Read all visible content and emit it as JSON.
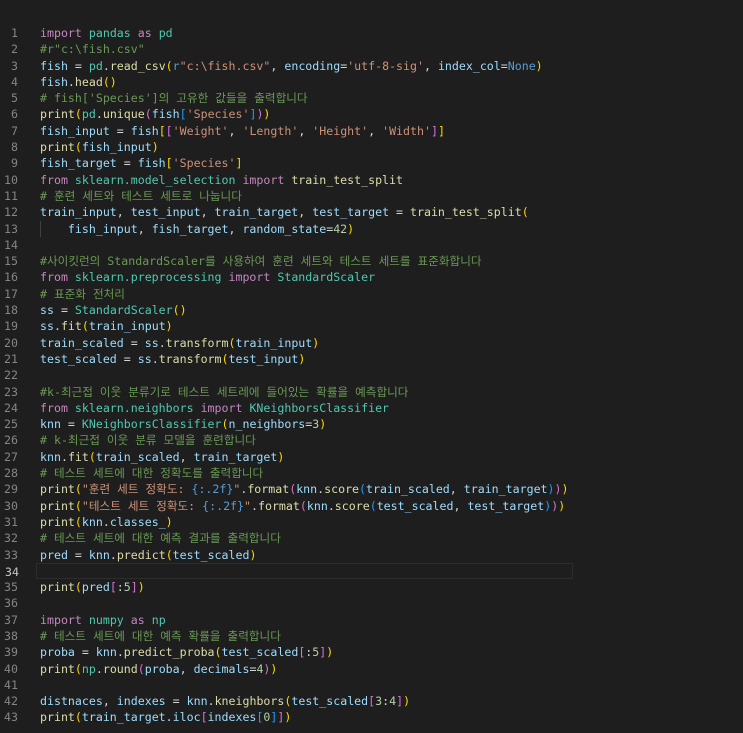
{
  "editor": {
    "current_line": 34,
    "lines": [
      [
        [
          "k",
          "import"
        ],
        [
          "p",
          " "
        ],
        [
          "t",
          "pandas"
        ],
        [
          "p",
          " "
        ],
        [
          "k",
          "as"
        ],
        [
          "p",
          " "
        ],
        [
          "t",
          "pd"
        ]
      ],
      [
        [
          "c",
          "#r\"c:\\fish.csv\""
        ]
      ],
      [
        [
          "v",
          "fish"
        ],
        [
          "p",
          " = "
        ],
        [
          "t",
          "pd"
        ],
        [
          "p",
          "."
        ],
        [
          "f",
          "read_csv"
        ],
        [
          "b1",
          "("
        ],
        [
          "kb",
          "r"
        ],
        [
          "s",
          "\"c:\\fish.csv\""
        ],
        [
          "p",
          ", "
        ],
        [
          "v",
          "encoding"
        ],
        [
          "p",
          "="
        ],
        [
          "s",
          "'utf-8-sig'"
        ],
        [
          "p",
          ", "
        ],
        [
          "v",
          "index_col"
        ],
        [
          "p",
          "="
        ],
        [
          "kb",
          "None"
        ],
        [
          "b1",
          ")"
        ]
      ],
      [
        [
          "v",
          "fish"
        ],
        [
          "p",
          "."
        ],
        [
          "f",
          "head"
        ],
        [
          "b1",
          "()"
        ]
      ],
      [
        [
          "c",
          "# fish['Species']의 고유한 값들을 출력합니다"
        ]
      ],
      [
        [
          "f",
          "print"
        ],
        [
          "b1",
          "("
        ],
        [
          "t",
          "pd"
        ],
        [
          "p",
          "."
        ],
        [
          "f",
          "unique"
        ],
        [
          "b2",
          "("
        ],
        [
          "v",
          "fish"
        ],
        [
          "b3",
          "["
        ],
        [
          "s",
          "'Species'"
        ],
        [
          "b3",
          "]"
        ],
        [
          "b2",
          ")"
        ],
        [
          "b1",
          ")"
        ]
      ],
      [
        [
          "v",
          "fish_input"
        ],
        [
          "p",
          " = "
        ],
        [
          "v",
          "fish"
        ],
        [
          "b1",
          "["
        ],
        [
          "b2",
          "["
        ],
        [
          "s",
          "'Weight'"
        ],
        [
          "p",
          ", "
        ],
        [
          "s",
          "'Length'"
        ],
        [
          "p",
          ", "
        ],
        [
          "s",
          "'Height'"
        ],
        [
          "p",
          ", "
        ],
        [
          "s",
          "'Width'"
        ],
        [
          "b2",
          "]"
        ],
        [
          "b1",
          "]"
        ]
      ],
      [
        [
          "f",
          "print"
        ],
        [
          "b1",
          "("
        ],
        [
          "v",
          "fish_input"
        ],
        [
          "b1",
          ")"
        ]
      ],
      [
        [
          "v",
          "fish_target"
        ],
        [
          "p",
          " = "
        ],
        [
          "v",
          "fish"
        ],
        [
          "b1",
          "["
        ],
        [
          "s",
          "'Species'"
        ],
        [
          "b1",
          "]"
        ]
      ],
      [
        [
          "k",
          "from"
        ],
        [
          "p",
          " "
        ],
        [
          "t",
          "sklearn.model_selection"
        ],
        [
          "p",
          " "
        ],
        [
          "k",
          "import"
        ],
        [
          "p",
          " "
        ],
        [
          "f",
          "train_test_split"
        ]
      ],
      [
        [
          "c",
          "# 훈련 세트와 테스트 세트로 나눕니다"
        ]
      ],
      [
        [
          "v",
          "train_input"
        ],
        [
          "p",
          ", "
        ],
        [
          "v",
          "test_input"
        ],
        [
          "p",
          ", "
        ],
        [
          "v",
          "train_target"
        ],
        [
          "p",
          ", "
        ],
        [
          "v",
          "test_target"
        ],
        [
          "p",
          " = "
        ],
        [
          "f",
          "train_test_split"
        ],
        [
          "b1",
          "("
        ]
      ],
      [
        [
          "p",
          "    "
        ],
        [
          "v",
          "fish_input"
        ],
        [
          "p",
          ", "
        ],
        [
          "v",
          "fish_target"
        ],
        [
          "p",
          ", "
        ],
        [
          "v",
          "random_state"
        ],
        [
          "p",
          "="
        ],
        [
          "n",
          "42"
        ],
        [
          "b1",
          ")"
        ]
      ],
      [],
      [
        [
          "c",
          "#사이킷런의 StandardScaler를 사용하여 훈련 세트와 테스트 세트를 표준화합니다"
        ]
      ],
      [
        [
          "k",
          "from"
        ],
        [
          "p",
          " "
        ],
        [
          "t",
          "sklearn.preprocessing"
        ],
        [
          "p",
          " "
        ],
        [
          "k",
          "import"
        ],
        [
          "p",
          " "
        ],
        [
          "t",
          "StandardScaler"
        ]
      ],
      [
        [
          "c",
          "# 표준화 전처리"
        ]
      ],
      [
        [
          "v",
          "ss"
        ],
        [
          "p",
          " = "
        ],
        [
          "t",
          "StandardScaler"
        ],
        [
          "b1",
          "()"
        ]
      ],
      [
        [
          "v",
          "ss"
        ],
        [
          "p",
          "."
        ],
        [
          "f",
          "fit"
        ],
        [
          "b1",
          "("
        ],
        [
          "v",
          "train_input"
        ],
        [
          "b1",
          ")"
        ]
      ],
      [
        [
          "v",
          "train_scaled"
        ],
        [
          "p",
          " = "
        ],
        [
          "v",
          "ss"
        ],
        [
          "p",
          "."
        ],
        [
          "f",
          "transform"
        ],
        [
          "b1",
          "("
        ],
        [
          "v",
          "train_input"
        ],
        [
          "b1",
          ")"
        ]
      ],
      [
        [
          "v",
          "test_scaled"
        ],
        [
          "p",
          " = "
        ],
        [
          "v",
          "ss"
        ],
        [
          "p",
          "."
        ],
        [
          "f",
          "transform"
        ],
        [
          "b1",
          "("
        ],
        [
          "v",
          "test_input"
        ],
        [
          "b1",
          ")"
        ]
      ],
      [],
      [
        [
          "c",
          "#k-최근접 이웃 분류기로 테스트 세트레에 들어있는 확률을 예측합니다"
        ]
      ],
      [
        [
          "k",
          "from"
        ],
        [
          "p",
          " "
        ],
        [
          "t",
          "sklearn.neighbors"
        ],
        [
          "p",
          " "
        ],
        [
          "k",
          "import"
        ],
        [
          "p",
          " "
        ],
        [
          "t",
          "KNeighborsClassifier"
        ]
      ],
      [
        [
          "v",
          "knn"
        ],
        [
          "p",
          " = "
        ],
        [
          "t",
          "KNeighborsClassifier"
        ],
        [
          "b1",
          "("
        ],
        [
          "v",
          "n_neighbors"
        ],
        [
          "p",
          "="
        ],
        [
          "n",
          "3"
        ],
        [
          "b1",
          ")"
        ]
      ],
      [
        [
          "c",
          "# k-최근접 이웃 분류 모델을 훈련합니다"
        ]
      ],
      [
        [
          "v",
          "knn"
        ],
        [
          "p",
          "."
        ],
        [
          "f",
          "fit"
        ],
        [
          "b1",
          "("
        ],
        [
          "v",
          "train_scaled"
        ],
        [
          "p",
          ", "
        ],
        [
          "v",
          "train_target"
        ],
        [
          "b1",
          ")"
        ]
      ],
      [
        [
          "c",
          "# 테스트 세트에 대한 정확도를 출력합니다"
        ]
      ],
      [
        [
          "f",
          "print"
        ],
        [
          "b1",
          "("
        ],
        [
          "s",
          "\"훈련 세트 정확도: "
        ],
        [
          "kb",
          "{:.2f}"
        ],
        [
          "s",
          "\""
        ],
        [
          "p",
          "."
        ],
        [
          "f",
          "format"
        ],
        [
          "b2",
          "("
        ],
        [
          "v",
          "knn"
        ],
        [
          "p",
          "."
        ],
        [
          "f",
          "score"
        ],
        [
          "b3",
          "("
        ],
        [
          "v",
          "train_scaled"
        ],
        [
          "p",
          ", "
        ],
        [
          "v",
          "train_target"
        ],
        [
          "b3",
          ")"
        ],
        [
          "b2",
          ")"
        ],
        [
          "b1",
          ")"
        ]
      ],
      [
        [
          "f",
          "print"
        ],
        [
          "b1",
          "("
        ],
        [
          "s",
          "\"테스트 세트 정확도: "
        ],
        [
          "kb",
          "{:.2f}"
        ],
        [
          "s",
          "\""
        ],
        [
          "p",
          "."
        ],
        [
          "f",
          "format"
        ],
        [
          "b2",
          "("
        ],
        [
          "v",
          "knn"
        ],
        [
          "p",
          "."
        ],
        [
          "f",
          "score"
        ],
        [
          "b3",
          "("
        ],
        [
          "v",
          "test_scaled"
        ],
        [
          "p",
          ", "
        ],
        [
          "v",
          "test_target"
        ],
        [
          "b3",
          ")"
        ],
        [
          "b2",
          ")"
        ],
        [
          "b1",
          ")"
        ]
      ],
      [
        [
          "f",
          "print"
        ],
        [
          "b1",
          "("
        ],
        [
          "v",
          "knn"
        ],
        [
          "p",
          "."
        ],
        [
          "v",
          "classes_"
        ],
        [
          "b1",
          ")"
        ]
      ],
      [
        [
          "c",
          "# 테스트 세트에 대한 예측 결과를 출력합니다"
        ]
      ],
      [
        [
          "v",
          "pred"
        ],
        [
          "p",
          " = "
        ],
        [
          "v",
          "knn"
        ],
        [
          "p",
          "."
        ],
        [
          "f",
          "predict"
        ],
        [
          "b1",
          "("
        ],
        [
          "v",
          "test_scaled"
        ],
        [
          "b1",
          ")"
        ]
      ],
      [],
      [
        [
          "f",
          "print"
        ],
        [
          "b1",
          "("
        ],
        [
          "v",
          "pred"
        ],
        [
          "b2",
          "["
        ],
        [
          "p",
          ":"
        ],
        [
          "n",
          "5"
        ],
        [
          "b2",
          "]"
        ],
        [
          "b1",
          ")"
        ]
      ],
      [],
      [
        [
          "k",
          "import"
        ],
        [
          "p",
          " "
        ],
        [
          "t",
          "numpy"
        ],
        [
          "p",
          " "
        ],
        [
          "k",
          "as"
        ],
        [
          "p",
          " "
        ],
        [
          "t",
          "np"
        ]
      ],
      [
        [
          "c",
          "# 테스트 세트에 대한 예측 확률을 출력합니다"
        ]
      ],
      [
        [
          "v",
          "proba"
        ],
        [
          "p",
          " = "
        ],
        [
          "v",
          "knn"
        ],
        [
          "p",
          "."
        ],
        [
          "f",
          "predict_proba"
        ],
        [
          "b1",
          "("
        ],
        [
          "v",
          "test_scaled"
        ],
        [
          "b2",
          "["
        ],
        [
          "p",
          ":"
        ],
        [
          "n",
          "5"
        ],
        [
          "b2",
          "]"
        ],
        [
          "b1",
          ")"
        ]
      ],
      [
        [
          "f",
          "print"
        ],
        [
          "b1",
          "("
        ],
        [
          "t",
          "np"
        ],
        [
          "p",
          "."
        ],
        [
          "f",
          "round"
        ],
        [
          "b2",
          "("
        ],
        [
          "v",
          "proba"
        ],
        [
          "p",
          ", "
        ],
        [
          "v",
          "decimals"
        ],
        [
          "p",
          "="
        ],
        [
          "n",
          "4"
        ],
        [
          "b2",
          ")"
        ],
        [
          "b1",
          ")"
        ]
      ],
      [],
      [
        [
          "v",
          "distnaces"
        ],
        [
          "p",
          ", "
        ],
        [
          "v",
          "indexes"
        ],
        [
          "p",
          " = "
        ],
        [
          "v",
          "knn"
        ],
        [
          "p",
          "."
        ],
        [
          "f",
          "kneighbors"
        ],
        [
          "b1",
          "("
        ],
        [
          "v",
          "test_scaled"
        ],
        [
          "b2",
          "["
        ],
        [
          "n",
          "3"
        ],
        [
          "p",
          ":"
        ],
        [
          "n",
          "4"
        ],
        [
          "b2",
          "]"
        ],
        [
          "b1",
          ")"
        ]
      ],
      [
        [
          "f",
          "print"
        ],
        [
          "b1",
          "("
        ],
        [
          "v",
          "train_target"
        ],
        [
          "p",
          "."
        ],
        [
          "v",
          "iloc"
        ],
        [
          "b2",
          "["
        ],
        [
          "v",
          "indexes"
        ],
        [
          "b3",
          "["
        ],
        [
          "n",
          "0"
        ],
        [
          "b3",
          "]"
        ],
        [
          "b2",
          "]"
        ],
        [
          "b1",
          ")"
        ]
      ]
    ]
  }
}
